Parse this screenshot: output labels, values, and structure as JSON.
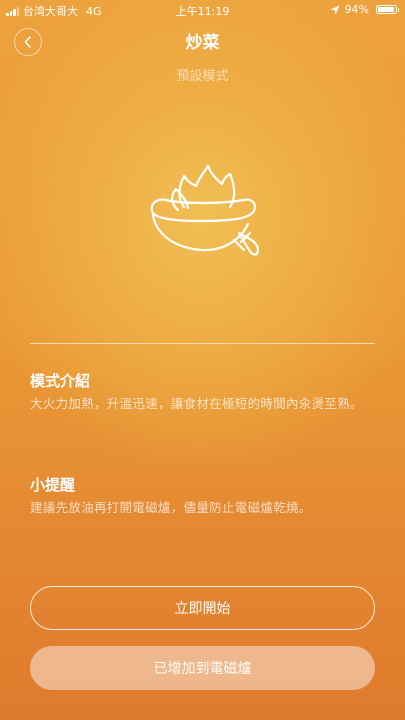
{
  "status_bar": {
    "carrier": "台湾大哥大",
    "network": "4G",
    "time": "上午11:19",
    "battery": "94%",
    "battery_level": 0.94
  },
  "header": {
    "title": "炒菜",
    "subtitle": "預設模式",
    "back_icon": "chevron-left-icon"
  },
  "illustration": {
    "icon": "wok-flame-icon"
  },
  "mode_intro": {
    "heading": "模式介紹",
    "text": "大火力加熱，升溫迅速，讓食材在極短的時間內汆燙至熟。"
  },
  "tip": {
    "heading": "小提醒",
    "text": "建議先放油再打開電磁爐，儘量防止電磁爐乾燒。"
  },
  "actions": {
    "start_label": "立即開始",
    "added_label": "已增加到電磁爐"
  },
  "colors": {
    "background_top": "#eda23d",
    "background_bottom": "#de7a2c",
    "glow": "#f1bf55"
  }
}
